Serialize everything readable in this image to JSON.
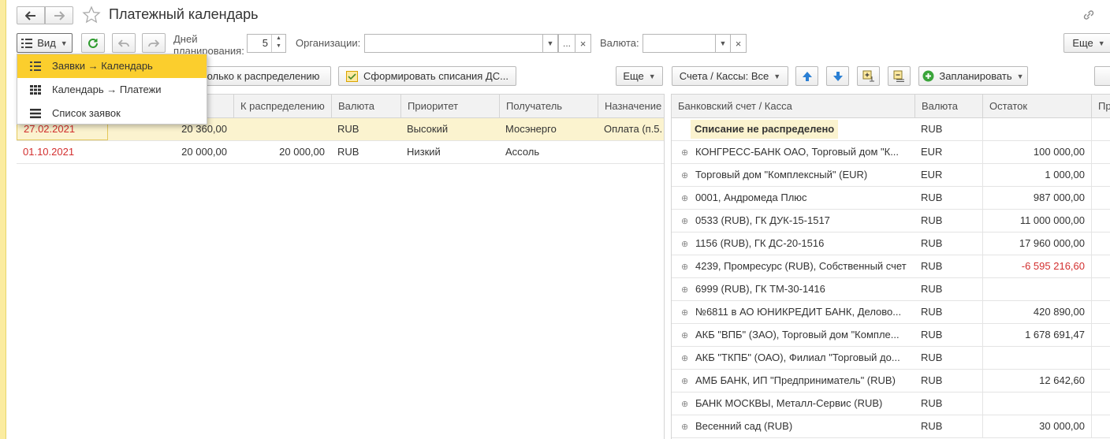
{
  "header": {
    "title": "Платежный календарь"
  },
  "toolbar": {
    "view_label": "Вид",
    "days_label_line1": "Дней",
    "days_label_line2": "планирования:",
    "days_value": "5",
    "org_label": "Организации:",
    "org_value": "",
    "currency_label": "Валюта:",
    "currency_value": "",
    "ellipsis": "...",
    "clear": "×",
    "more_label": "Еще"
  },
  "view_menu": {
    "items": [
      {
        "label": "Заявки → Календарь",
        "active": true
      },
      {
        "label": "Календарь → Платежи",
        "active": false
      },
      {
        "label": "Список заявок",
        "active": false
      }
    ]
  },
  "left_panel": {
    "only_distribution_label": "олько к распределению",
    "form_writeoffs_label": "Сформировать списания ДС...",
    "more_label": "Еще",
    "columns": [
      "К распределению",
      "Валюта",
      "Приоритет",
      "Получатель",
      "Назначение"
    ],
    "rows": [
      {
        "date": "27.02.2021",
        "amount": "20 360,00",
        "to_distribute": "",
        "currency": "RUB",
        "priority": "Высокий",
        "recipient": "Мосэнерго",
        "purpose": "Оплата (п.5."
      },
      {
        "date": "01.10.2021",
        "amount": "20 000,00",
        "to_distribute": "20 000,00",
        "currency": "RUB",
        "priority": "Низкий",
        "recipient": "Ассоль",
        "purpose": ""
      }
    ]
  },
  "right_panel": {
    "accounts_filter_label": "Счета / Кассы: Все",
    "plan_label": "Запланировать",
    "columns": [
      "Банковский счет / Касса",
      "Валюта",
      "Остаток",
      "Пр"
    ],
    "rows": [
      {
        "name": "Списание не распределено",
        "currency": "RUB",
        "balance": "",
        "bold": true
      },
      {
        "name": "КОНГРЕСС-БАНК ОАО, Торговый дом \"К...",
        "currency": "EUR",
        "balance": "100 000,00"
      },
      {
        "name": "Торговый дом \"Комплексный\" (EUR)",
        "currency": "EUR",
        "balance": "1 000,00"
      },
      {
        "name": "0001, Андромеда Плюс",
        "currency": "RUB",
        "balance": "987 000,00"
      },
      {
        "name": "0533 (RUB), ГК ДУК-15-1517",
        "currency": "RUB",
        "balance": "11 000 000,00"
      },
      {
        "name": "1156 (RUB), ГК ДС-20-1516",
        "currency": "RUB",
        "balance": "17 960 000,00"
      },
      {
        "name": "4239, Промресурс (RUB), Собственный счет",
        "currency": "RUB",
        "balance": "-6 595 216,60",
        "negative": true
      },
      {
        "name": "6999 (RUB), ГК ТМ-30-1416",
        "currency": "RUB",
        "balance": ""
      },
      {
        "name": "№6811 в АО ЮНИКРЕДИТ БАНК, Делово...",
        "currency": "RUB",
        "balance": "420 890,00"
      },
      {
        "name": "АКБ \"ВПБ\" (ЗАО), Торговый дом \"Компле...",
        "currency": "RUB",
        "balance": "1 678 691,47"
      },
      {
        "name": "АКБ \"ТКПБ\" (ОАО), Филиал \"Торговый до...",
        "currency": "RUB",
        "balance": ""
      },
      {
        "name": "АМБ БАНК, ИП \"Предприниматель\" (RUB)",
        "currency": "RUB",
        "balance": "12 642,60"
      },
      {
        "name": "БАНК МОСКВЫ, Металл-Сервис (RUB)",
        "currency": "RUB",
        "balance": ""
      },
      {
        "name": "Весенний сад (RUB)",
        "currency": "RUB",
        "balance": "30 000,00"
      }
    ]
  },
  "colors": {
    "accent_yellow": "#fbce2d",
    "selected_row": "#fbf3cf",
    "negative": "#d32f2f",
    "refresh_green": "#2e9b2e",
    "arrow_blue": "#2a7fd4"
  }
}
